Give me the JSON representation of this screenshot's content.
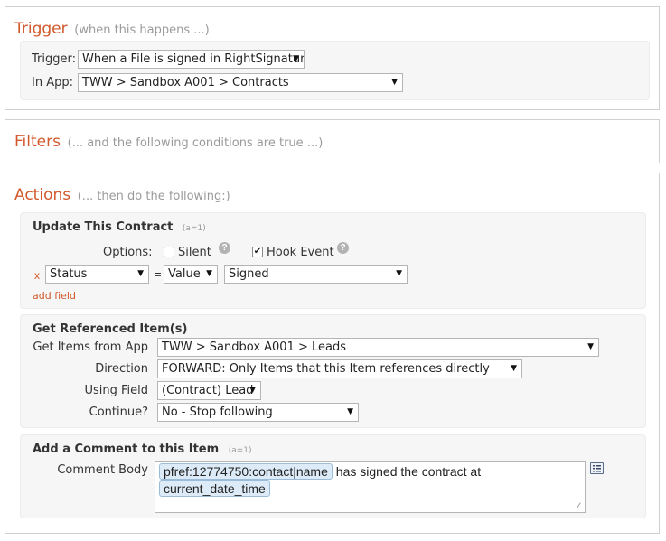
{
  "trigger": {
    "title": "Trigger",
    "hint": "(when this happens ...)",
    "trigger_label": "Trigger:",
    "trigger_value": "When a File is signed in RightSignature",
    "app_label": "In App:",
    "app_value": "TWW > Sandbox A001 > Contracts"
  },
  "filters": {
    "title": "Filters",
    "hint": "(... and the following conditions are true ...)"
  },
  "actions": {
    "title": "Actions",
    "hint": "(... then do the following:)",
    "update": {
      "title": "Update This Contract",
      "meta": "(a=1)",
      "options_label": "Options:",
      "silent_label": "Silent",
      "silent_checked": false,
      "hook_label": "Hook Event",
      "hook_checked": true,
      "remove": "x",
      "field_value": "Status",
      "equals": "=",
      "type_value": "Value",
      "value_value": "Signed",
      "add_field": "add field"
    },
    "referenced": {
      "title": "Get Referenced Item(s)",
      "from_app_label": "Get Items from App",
      "from_app_value": "TWW > Sandbox A001 > Leads",
      "direction_label": "Direction",
      "direction_value": "FORWARD: Only Items that this Item references directly",
      "using_field_label": "Using Field",
      "using_field_value": "(Contract) Lead",
      "continue_label": "Continue?",
      "continue_value": "No - Stop following"
    },
    "comment": {
      "title": "Add a Comment to this Item",
      "meta": "(a=1)",
      "body_label": "Comment Body",
      "token1": "pfref:12774750:contact|name",
      "text1": "has signed the contract at",
      "token2": "current_date_time"
    }
  },
  "icons": {
    "dropdown": "caret-down-icon",
    "help": "question-circle-icon",
    "token_picker": "token-picker-icon",
    "resize": "resize-grip-icon"
  },
  "colors": {
    "accent": "#d2592c",
    "token_bg": "#dcebf7",
    "hint": "#9a9a9a"
  }
}
